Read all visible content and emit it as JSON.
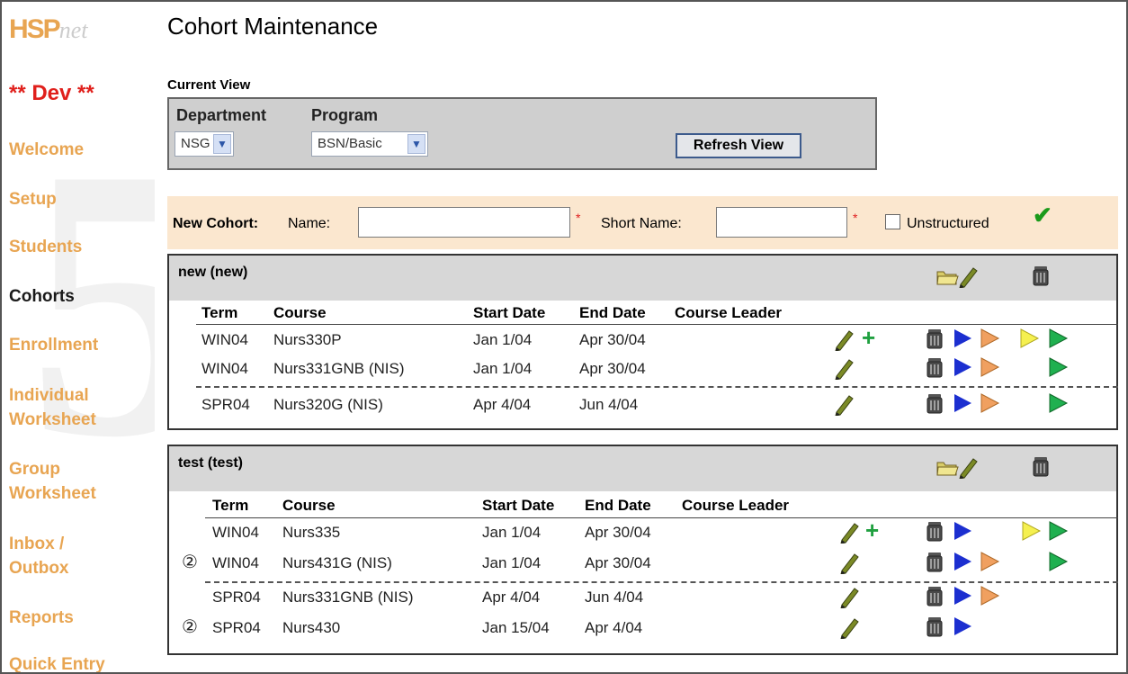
{
  "sidebar": {
    "logo_main": "HSP",
    "logo_suffix": "net",
    "env_label": "** Dev **",
    "items": [
      {
        "label": "Welcome"
      },
      {
        "label": "Setup"
      },
      {
        "label": "Students"
      },
      {
        "label": "Cohorts"
      },
      {
        "label": "Enrollment"
      },
      {
        "label": "Individual"
      },
      {
        "label": "Worksheet"
      },
      {
        "label": "Group"
      },
      {
        "label": "Worksheet"
      },
      {
        "label": "Inbox /"
      },
      {
        "label": "Outbox"
      },
      {
        "label": "Reports"
      },
      {
        "label": "Quick Entry"
      }
    ]
  },
  "page": {
    "title": "Cohort Maintenance"
  },
  "current_view": {
    "label": "Current View",
    "department_label": "Department",
    "department_value": "NSG",
    "program_label": "Program",
    "program_value": "BSN/Basic",
    "refresh_label": "Refresh View"
  },
  "new_cohort": {
    "title": "New Cohort:",
    "name_label": "Name:",
    "name_value": "",
    "short_name_label": "Short Name:",
    "short_name_value": "",
    "required_mark": "*",
    "unstructured_label": "Unstructured"
  },
  "columns": {
    "term": "Term",
    "course": "Course",
    "start": "Start Date",
    "end": "End Date",
    "leader": "Course Leader"
  },
  "cohorts": [
    {
      "title": "new  (new)",
      "rows": [
        {
          "term": "WIN04",
          "course": "Nurs330P",
          "start": "Jan 1/04",
          "end": "Apr 30/04",
          "leader": ""
        },
        {
          "term": "WIN04",
          "course": "Nurs331GNB  (NIS)",
          "start": "Jan 1/04",
          "end": "Apr 30/04",
          "leader": ""
        },
        {
          "term": "SPR04",
          "course": "Nurs320G  (NIS)",
          "start": "Apr 4/04",
          "end": "Jun 4/04",
          "leader": ""
        }
      ]
    },
    {
      "title": "test  (test)",
      "rows": [
        {
          "term": "WIN04",
          "course": "Nurs335",
          "start": "Jan 1/04",
          "end": "Apr 30/04",
          "leader": ""
        },
        {
          "term": "WIN04",
          "course": "Nurs431G  (NIS)",
          "start": "Jan 1/04",
          "end": "Apr 30/04",
          "leader": "",
          "badge": "②"
        },
        {
          "term": "SPR04",
          "course": "Nurs331GNB  (NIS)",
          "start": "Apr 4/04",
          "end": "Jun 4/04",
          "leader": ""
        },
        {
          "term": "SPR04",
          "course": "Nurs430",
          "start": "Jan 15/04",
          "end": "Apr 4/04",
          "leader": "",
          "badge": "②"
        }
      ]
    }
  ],
  "colors": {
    "nav_orange": "#e8a552",
    "dev_red": "#e0201c",
    "new_cohort_bg": "#fbe7cf",
    "arrow_blue": "#1c2fd0",
    "arrow_orange": "#f0a060",
    "arrow_yellow": "#f5f050",
    "arrow_green": "#20b050",
    "check_green": "#1a9a1a"
  },
  "icons": [
    "pencil-icon",
    "plus-icon",
    "trash-icon",
    "folder-icon",
    "check-icon",
    "arrow-blue-icon",
    "arrow-orange-icon",
    "arrow-yellow-icon",
    "arrow-green-icon"
  ]
}
